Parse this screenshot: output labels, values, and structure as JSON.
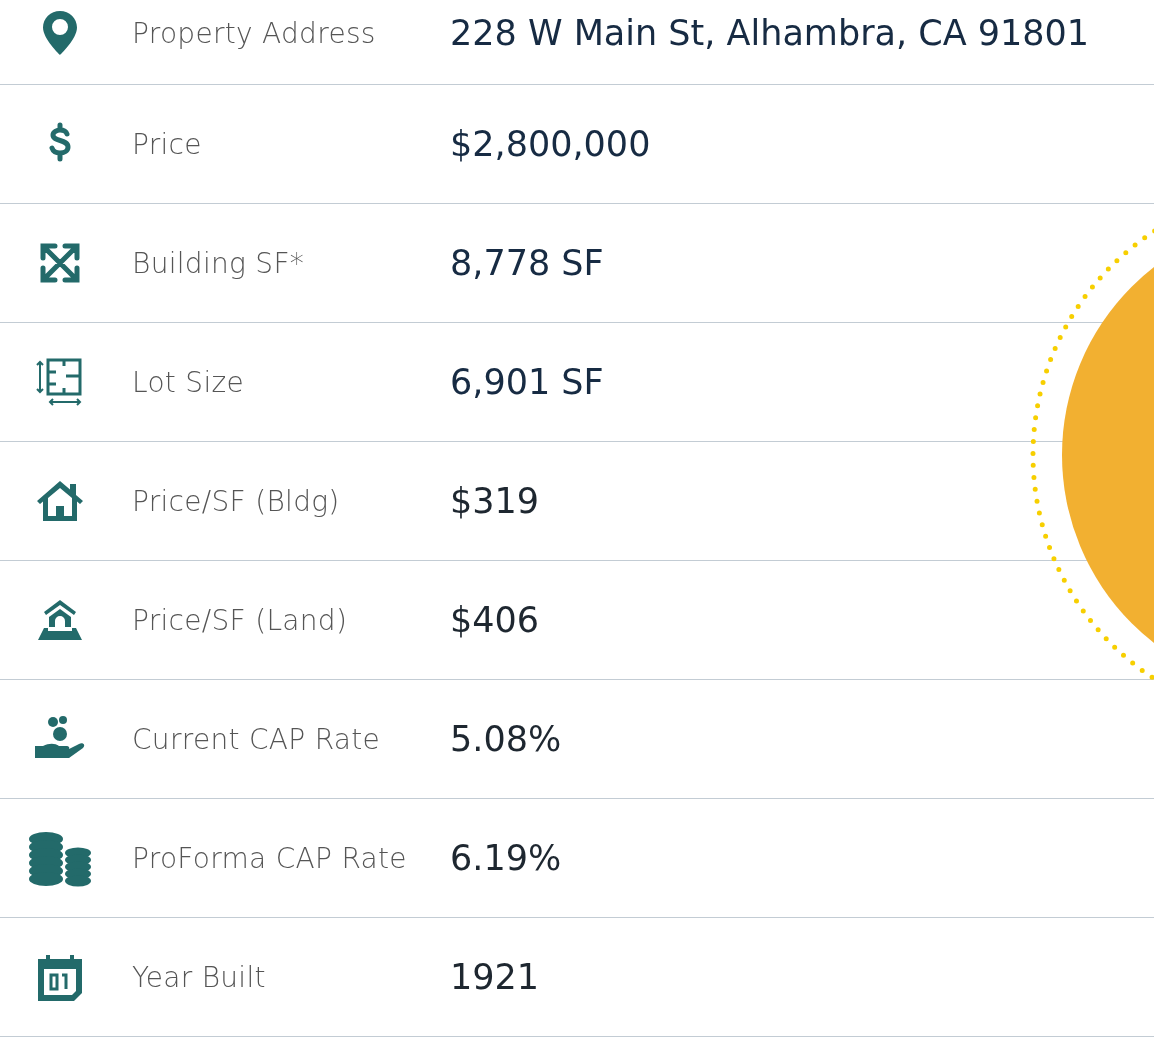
{
  "rows": [
    {
      "label": "Property Address",
      "value": "228 W Main St, Alhambra, CA 91801"
    },
    {
      "label": "Price",
      "value": "$2,800,000"
    },
    {
      "label": "Building SF*",
      "value": "8,778 SF"
    },
    {
      "label": "Lot Size",
      "value": "6,901 SF"
    },
    {
      "label": "Price/SF (Bldg)",
      "value": "$319"
    },
    {
      "label": "Price/SF (Land)",
      "value": "$406"
    },
    {
      "label": "Current CAP Rate",
      "value": "5.08%"
    },
    {
      "label": "ProForma CAP Rate",
      "value": "6.19%"
    },
    {
      "label": "Year Built",
      "value": "1921"
    }
  ]
}
